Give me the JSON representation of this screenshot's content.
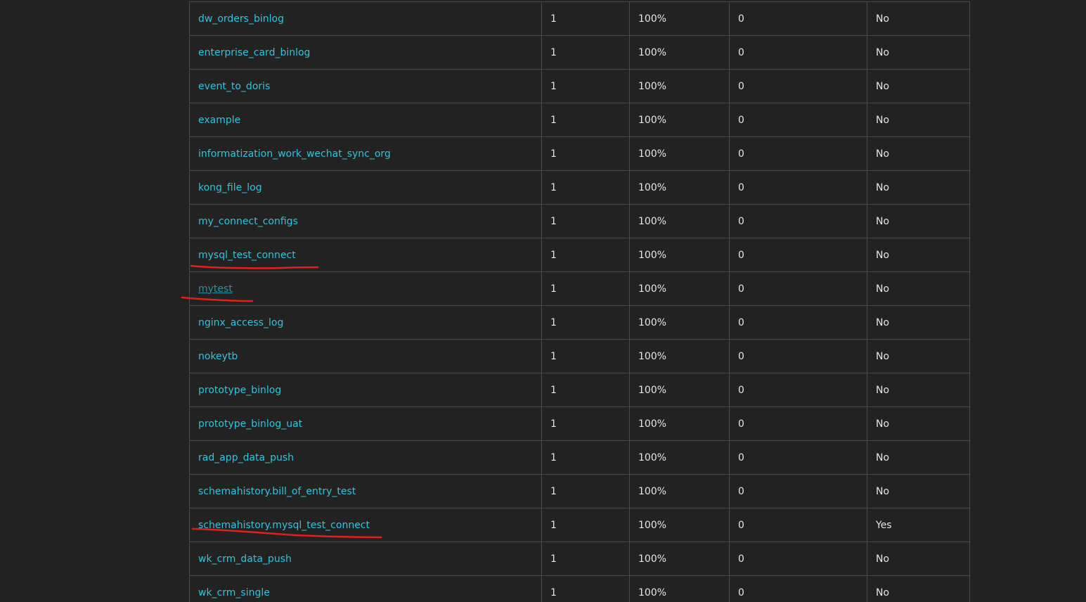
{
  "topics_table": {
    "rows": [
      {
        "name": "dw_orders_binlog",
        "partitions": "1",
        "preferred_pct": "100%",
        "under_replicated": "0",
        "internal": "No",
        "visited": false
      },
      {
        "name": "enterprise_card_binlog",
        "partitions": "1",
        "preferred_pct": "100%",
        "under_replicated": "0",
        "internal": "No",
        "visited": false
      },
      {
        "name": "event_to_doris",
        "partitions": "1",
        "preferred_pct": "100%",
        "under_replicated": "0",
        "internal": "No",
        "visited": false
      },
      {
        "name": "example",
        "partitions": "1",
        "preferred_pct": "100%",
        "under_replicated": "0",
        "internal": "No",
        "visited": false
      },
      {
        "name": "informatization_work_wechat_sync_org",
        "partitions": "1",
        "preferred_pct": "100%",
        "under_replicated": "0",
        "internal": "No",
        "visited": false
      },
      {
        "name": "kong_file_log",
        "partitions": "1",
        "preferred_pct": "100%",
        "under_replicated": "0",
        "internal": "No",
        "visited": false
      },
      {
        "name": "my_connect_configs",
        "partitions": "1",
        "preferred_pct": "100%",
        "under_replicated": "0",
        "internal": "No",
        "visited": false
      },
      {
        "name": "mysql_test_connect",
        "partitions": "1",
        "preferred_pct": "100%",
        "under_replicated": "0",
        "internal": "No",
        "visited": false
      },
      {
        "name": "mytest",
        "partitions": "1",
        "preferred_pct": "100%",
        "under_replicated": "0",
        "internal": "No",
        "visited": true
      },
      {
        "name": "nginx_access_log",
        "partitions": "1",
        "preferred_pct": "100%",
        "under_replicated": "0",
        "internal": "No",
        "visited": false
      },
      {
        "name": "nokeytb",
        "partitions": "1",
        "preferred_pct": "100%",
        "under_replicated": "0",
        "internal": "No",
        "visited": false
      },
      {
        "name": "prototype_binlog",
        "partitions": "1",
        "preferred_pct": "100%",
        "under_replicated": "0",
        "internal": "No",
        "visited": false
      },
      {
        "name": "prototype_binlog_uat",
        "partitions": "1",
        "preferred_pct": "100%",
        "under_replicated": "0",
        "internal": "No",
        "visited": false
      },
      {
        "name": "rad_app_data_push",
        "partitions": "1",
        "preferred_pct": "100%",
        "under_replicated": "0",
        "internal": "No",
        "visited": false
      },
      {
        "name": "schemahistory.bill_of_entry_test",
        "partitions": "1",
        "preferred_pct": "100%",
        "under_replicated": "0",
        "internal": "No",
        "visited": false
      },
      {
        "name": "schemahistory.mysql_test_connect",
        "partitions": "1",
        "preferred_pct": "100%",
        "under_replicated": "0",
        "internal": "Yes",
        "visited": false
      },
      {
        "name": "wk_crm_data_push",
        "partitions": "1",
        "preferred_pct": "100%",
        "under_replicated": "0",
        "internal": "No",
        "visited": false
      },
      {
        "name": "wk_crm_single",
        "partitions": "1",
        "preferred_pct": "100%",
        "under_replicated": "0",
        "internal": "No",
        "visited": false
      }
    ]
  },
  "colors": {
    "background": "#222222",
    "link": "#2ec5e0",
    "visited_link": "#2b8fa3",
    "cell_text": "#e6e6e6",
    "grid": "#4a4a4a",
    "annotation_underline": "#e0201a"
  }
}
